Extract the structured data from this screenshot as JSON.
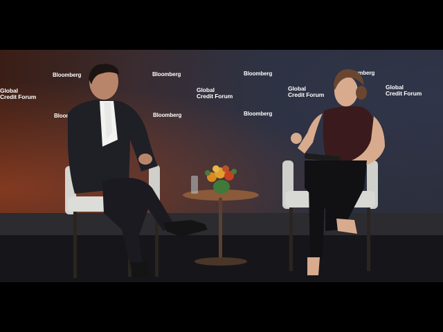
{
  "backdrop": {
    "brand_word": "Bloomberg",
    "event_line1": "Global",
    "event_line2": "Credit Forum"
  },
  "colors": {
    "letterbox": "#000000",
    "backdrop_warm": "#7a3520",
    "backdrop_cool": "#2a2c36",
    "chair": "#d9d9d6",
    "table": "#8a5a3a",
    "floor": "#16161a"
  }
}
